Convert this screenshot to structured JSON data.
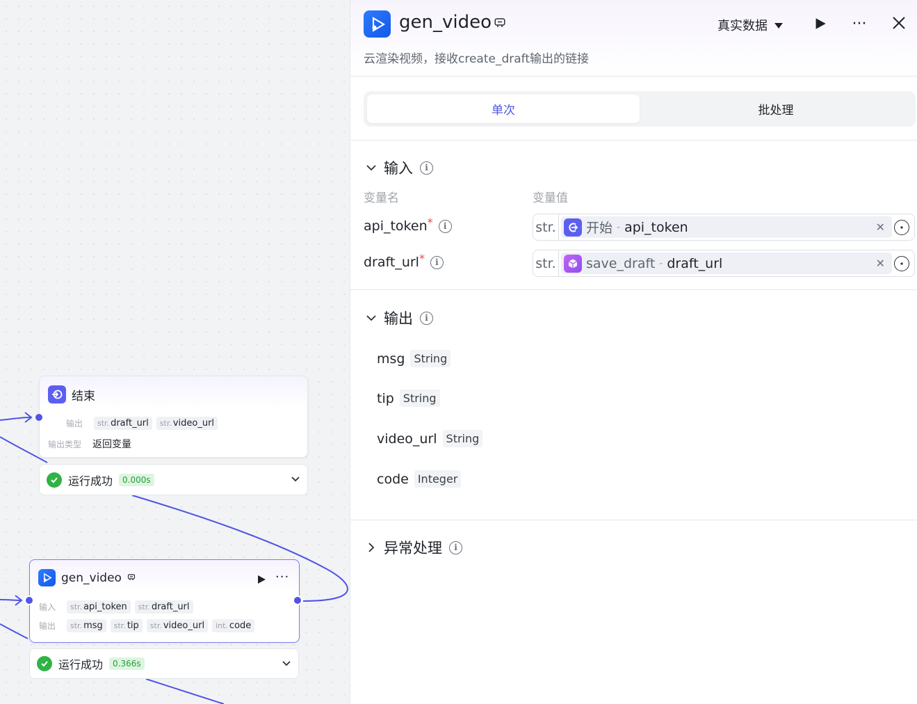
{
  "canvas": {
    "end_node": {
      "title": "结束",
      "output_key": "输出",
      "outputs": [
        {
          "type": "str.",
          "name": "draft_url"
        },
        {
          "type": "str.",
          "name": "video_url"
        }
      ],
      "output_type_key": "输出类型",
      "output_type_value": "返回变量",
      "run_status": "运行成功",
      "run_time": "0.000s"
    },
    "gen_node": {
      "title": "gen_video",
      "input_key": "输入",
      "inputs": [
        {
          "type": "str.",
          "name": "api_token"
        },
        {
          "type": "str.",
          "name": "draft_url"
        }
      ],
      "output_key": "输出",
      "outputs": [
        {
          "type": "str.",
          "name": "msg"
        },
        {
          "type": "str.",
          "name": "tip"
        },
        {
          "type": "str.",
          "name": "video_url"
        },
        {
          "type": "int.",
          "name": "code"
        }
      ],
      "run_status": "运行成功",
      "run_time": "0.366s"
    }
  },
  "panel": {
    "title": "gen_video",
    "description": "云渲染视频，接收create_draft输出的链接",
    "data_source": "真实数据",
    "tabs": [
      {
        "label": "单次",
        "active": true
      },
      {
        "label": "批处理",
        "active": false
      }
    ],
    "input_section": {
      "title": "输入",
      "col_name": "变量名",
      "col_value": "变量值",
      "rows": [
        {
          "name": "api_token",
          "required": "*",
          "type": "str.",
          "source": "开始",
          "sep": "-",
          "variable": "api_token"
        },
        {
          "name": "draft_url",
          "required": "*",
          "type": "str.",
          "source": "save_draft",
          "sep": "-",
          "variable": "draft_url"
        }
      ]
    },
    "output_section": {
      "title": "输出",
      "rows": [
        {
          "name": "msg",
          "type": "String"
        },
        {
          "name": "tip",
          "type": "String"
        },
        {
          "name": "video_url",
          "type": "String"
        },
        {
          "name": "code",
          "type": "Integer"
        }
      ]
    },
    "exception_section": {
      "title": "异常处理"
    }
  },
  "colors": {
    "accent": "#4e54e6",
    "edge": "#4e54e6",
    "success": "#2fb344",
    "logo_blue": "#1f6bff",
    "save_draft_icon": "#a64ef0"
  }
}
